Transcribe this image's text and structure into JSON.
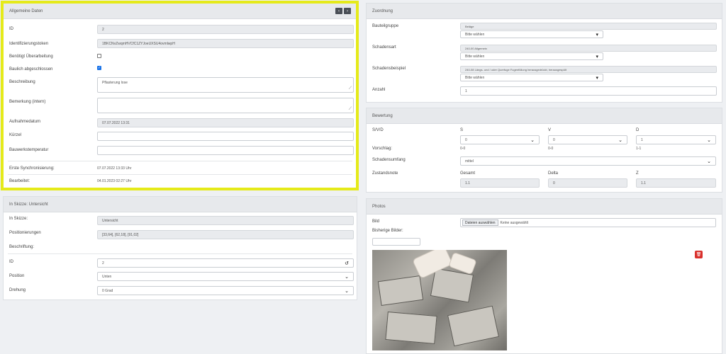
{
  "allgemein": {
    "title": "Allgemeine Daten",
    "nav_prev": "‹",
    "nav_next": "›",
    "id_label": "ID",
    "id_value": "2",
    "token_label": "Identifizierungstoken",
    "token_value": "1BKCNvZwqmHVCfC1ZYJoeUXSU4ovmlwpH",
    "ueberarbeitung_label": "Benötigt Überarbeitung",
    "ueberarbeitung_checked": false,
    "abgeschlossen_label": "Baulich abgeschlossen",
    "abgeschlossen_checked": true,
    "beschreibung_label": "Beschreibung",
    "beschreibung_value": "Pflasterung lose",
    "bemerkung_label": "Bemerkung (intern)",
    "bemerkung_value": "",
    "aufnahme_label": "Aufnahmedatum",
    "aufnahme_value": "07.07.2022 13:31",
    "kuerzel_label": "Kürzel",
    "kuerzel_value": "",
    "temp_label": "Bauwerkstemperatur",
    "temp_value": "",
    "sync_label": "Erste Synchronisierung:",
    "sync_value": "07.07.2022 13:33 Uhr",
    "bearbeitet_label": "Bearbeitet:",
    "bearbeitet_value": "04.01.2023 02:27 Uhr"
  },
  "skizze": {
    "title": "In Skizze: Untersicht",
    "inskizze_label": "In Skizze:",
    "inskizze_value": "Untersicht",
    "positionierungen_label": "Positionierungen",
    "positionierungen_value": "[33,64], [62,18], [91,02]",
    "beschriftung_label": "Beschriftung:",
    "id_label": "ID",
    "id_value": "2",
    "position_label": "Position",
    "position_value": "Unten",
    "drehung_label": "Drehung",
    "drehung_value": "0 Grad"
  },
  "zuordnung": {
    "title": "Zuordnung",
    "bauteilgruppe_label": "Bauteilgruppe",
    "bauteilgruppe_value": "Beläge",
    "schadensart_label": "Schadensart",
    "schadensart_value": "240-00 Allgemein",
    "schadensbeispiel_label": "Schadensbeispiel",
    "schadensbeispiel_value": "240-08 Längs- und / oder Querfuge Fugenfüllung herausgedrückt, herausgespült",
    "bitte_waehlen": "Bitte wählen",
    "anzahl_label": "Anzahl",
    "anzahl_value": "1"
  },
  "bewertung": {
    "title": "Bewertung",
    "svd_label": "S/V/D",
    "s_label": "S",
    "v_label": "V",
    "d_label": "D",
    "s_value": "0",
    "v_value": "0",
    "d_value": "1",
    "vorschlag_label": "Vorschlag:",
    "vorschlag_s": "0-0",
    "vorschlag_v": "0-0",
    "vorschlag_d": "1-1",
    "umfang_label": "Schadensumfang",
    "umfang_value": "mittel",
    "zustand_label": "Zustandsnote",
    "gesamt_label": "Gesamt",
    "delta_label": "Delta",
    "z_label": "Z",
    "gesamt_value": "1.1",
    "delta_value": "0",
    "z_value": "1.1"
  },
  "photos": {
    "title": "Photos",
    "bild_label": "Bild",
    "file_button": "Dateien auswählen",
    "file_status": "Keine ausgewählt",
    "bisherige_label": "Bisherige Bilder:",
    "delete_icon": "trash-icon"
  }
}
